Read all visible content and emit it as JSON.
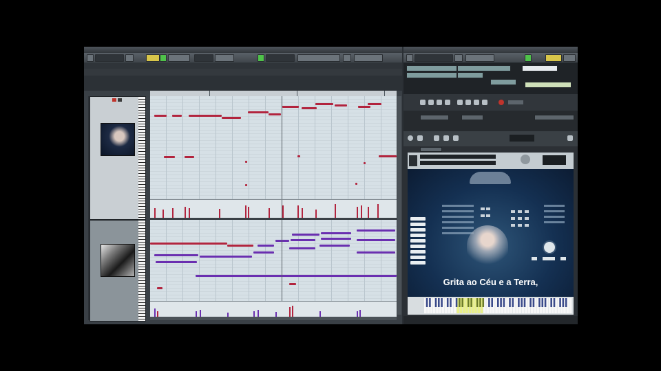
{
  "lyrics": "Grita ao Céu e a Terra,",
  "colors": {
    "note_red": "#b2243e",
    "note_purple": "#6a2fb0",
    "lane_bg": "#d6e0e6",
    "accent_green": "#4fc24a",
    "sampler_bg": "#143052"
  },
  "icons": [
    "transport-play-icon",
    "transport-stop-icon",
    "record-icon",
    "edit-tool-icon",
    "knob-icon"
  ]
}
